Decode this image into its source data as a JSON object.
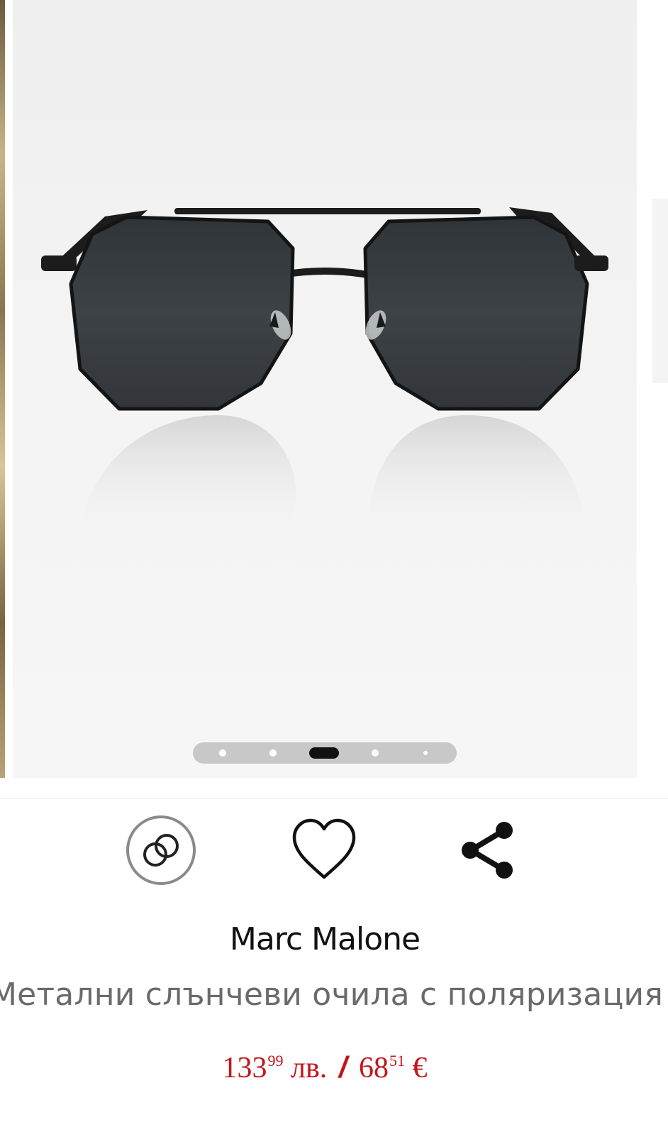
{
  "gallery": {
    "image_alt": "Marc Malone metal polarized sunglasses",
    "slide_count": 5,
    "active_slide": 3
  },
  "actions": {
    "compare_icon": "compare-rings-icon",
    "wishlist_icon": "heart-outline-icon",
    "share_icon": "share-icon"
  },
  "product": {
    "brand": "Marc Malone",
    "title": "Метални слънчеви очила с поляризация",
    "price": {
      "bgn_int": "133",
      "bgn_dec": "99",
      "bgn_currency": "лв.",
      "separator": "/",
      "eur_int": "68",
      "eur_dec": "51",
      "eur_currency": "€"
    }
  },
  "colors": {
    "price": "#c3161c",
    "brand": "#111111",
    "title": "#6a6a6a"
  }
}
